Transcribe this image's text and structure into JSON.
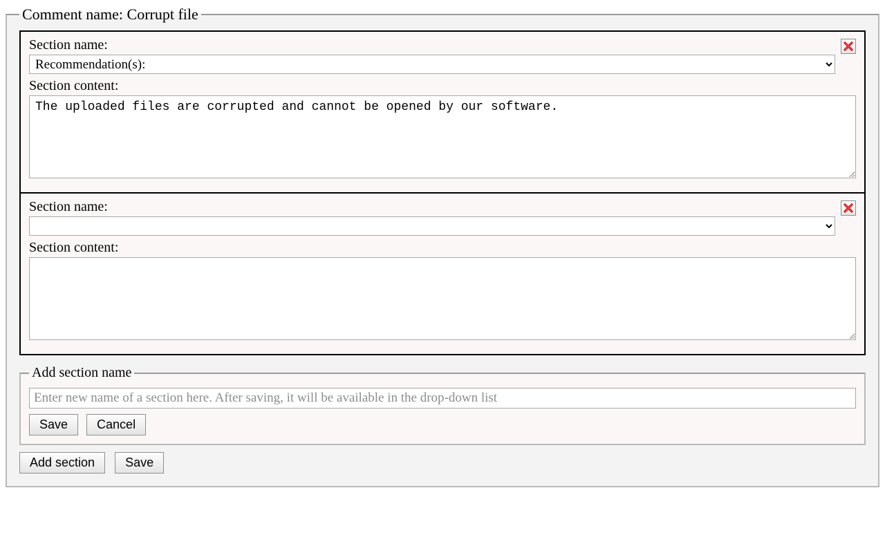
{
  "legend_prefix": "Comment name: ",
  "comment_name": "Corrupt file",
  "labels": {
    "section_name": "Section name:",
    "section_content": "Section content:"
  },
  "sections": [
    {
      "select_options": [
        "Recommendation(s):"
      ],
      "selected": "Recommendation(s):",
      "content": "The uploaded files are corrupted and cannot be opened by our software."
    },
    {
      "select_options": [
        ""
      ],
      "selected": "",
      "content": ""
    }
  ],
  "add_section_name": {
    "legend": "Add section name",
    "placeholder": "Enter new name of a section here. After saving, it will be available in the drop-down list",
    "save_label": "Save",
    "cancel_label": "Cancel"
  },
  "footer": {
    "add_section_label": "Add section",
    "save_label": "Save"
  }
}
